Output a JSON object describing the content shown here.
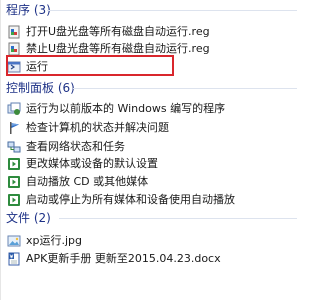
{
  "sections": {
    "programs": {
      "header": "程序 (3)",
      "items": [
        {
          "label": "打开U盘光盘等所有磁盘自动运行.reg",
          "icon": "reg-file-icon"
        },
        {
          "label": "禁止U盘光盘等所有磁盘自动运行.reg",
          "icon": "reg-file-icon"
        },
        {
          "label": "运行",
          "icon": "run-icon"
        }
      ]
    },
    "control_panel": {
      "header": "控制面板 (6)",
      "items": [
        {
          "label": "运行为以前版本的 Windows 编写的程序",
          "icon": "compat-icon"
        },
        {
          "label": "检查计算机的状态并解决问题",
          "icon": "action-center-flag-icon"
        },
        {
          "label": "查看网络状态和任务",
          "icon": "network-icon"
        },
        {
          "label": "更改媒体或设备的默认设置",
          "icon": "autoplay-icon"
        },
        {
          "label": "自动播放 CD 或其他媒体",
          "icon": "autoplay-icon"
        },
        {
          "label": "启动或停止为所有媒体和设备使用自动播放",
          "icon": "autoplay-icon"
        }
      ]
    },
    "files": {
      "header": "文件 (2)",
      "items": [
        {
          "label": "xp运行.jpg",
          "icon": "image-file-icon"
        },
        {
          "label": "APK更新手册 更新至2015.04.23.docx",
          "icon": "doc-file-icon"
        }
      ]
    }
  },
  "colors": {
    "header": "#1e3287",
    "highlight": "#d9262c"
  }
}
